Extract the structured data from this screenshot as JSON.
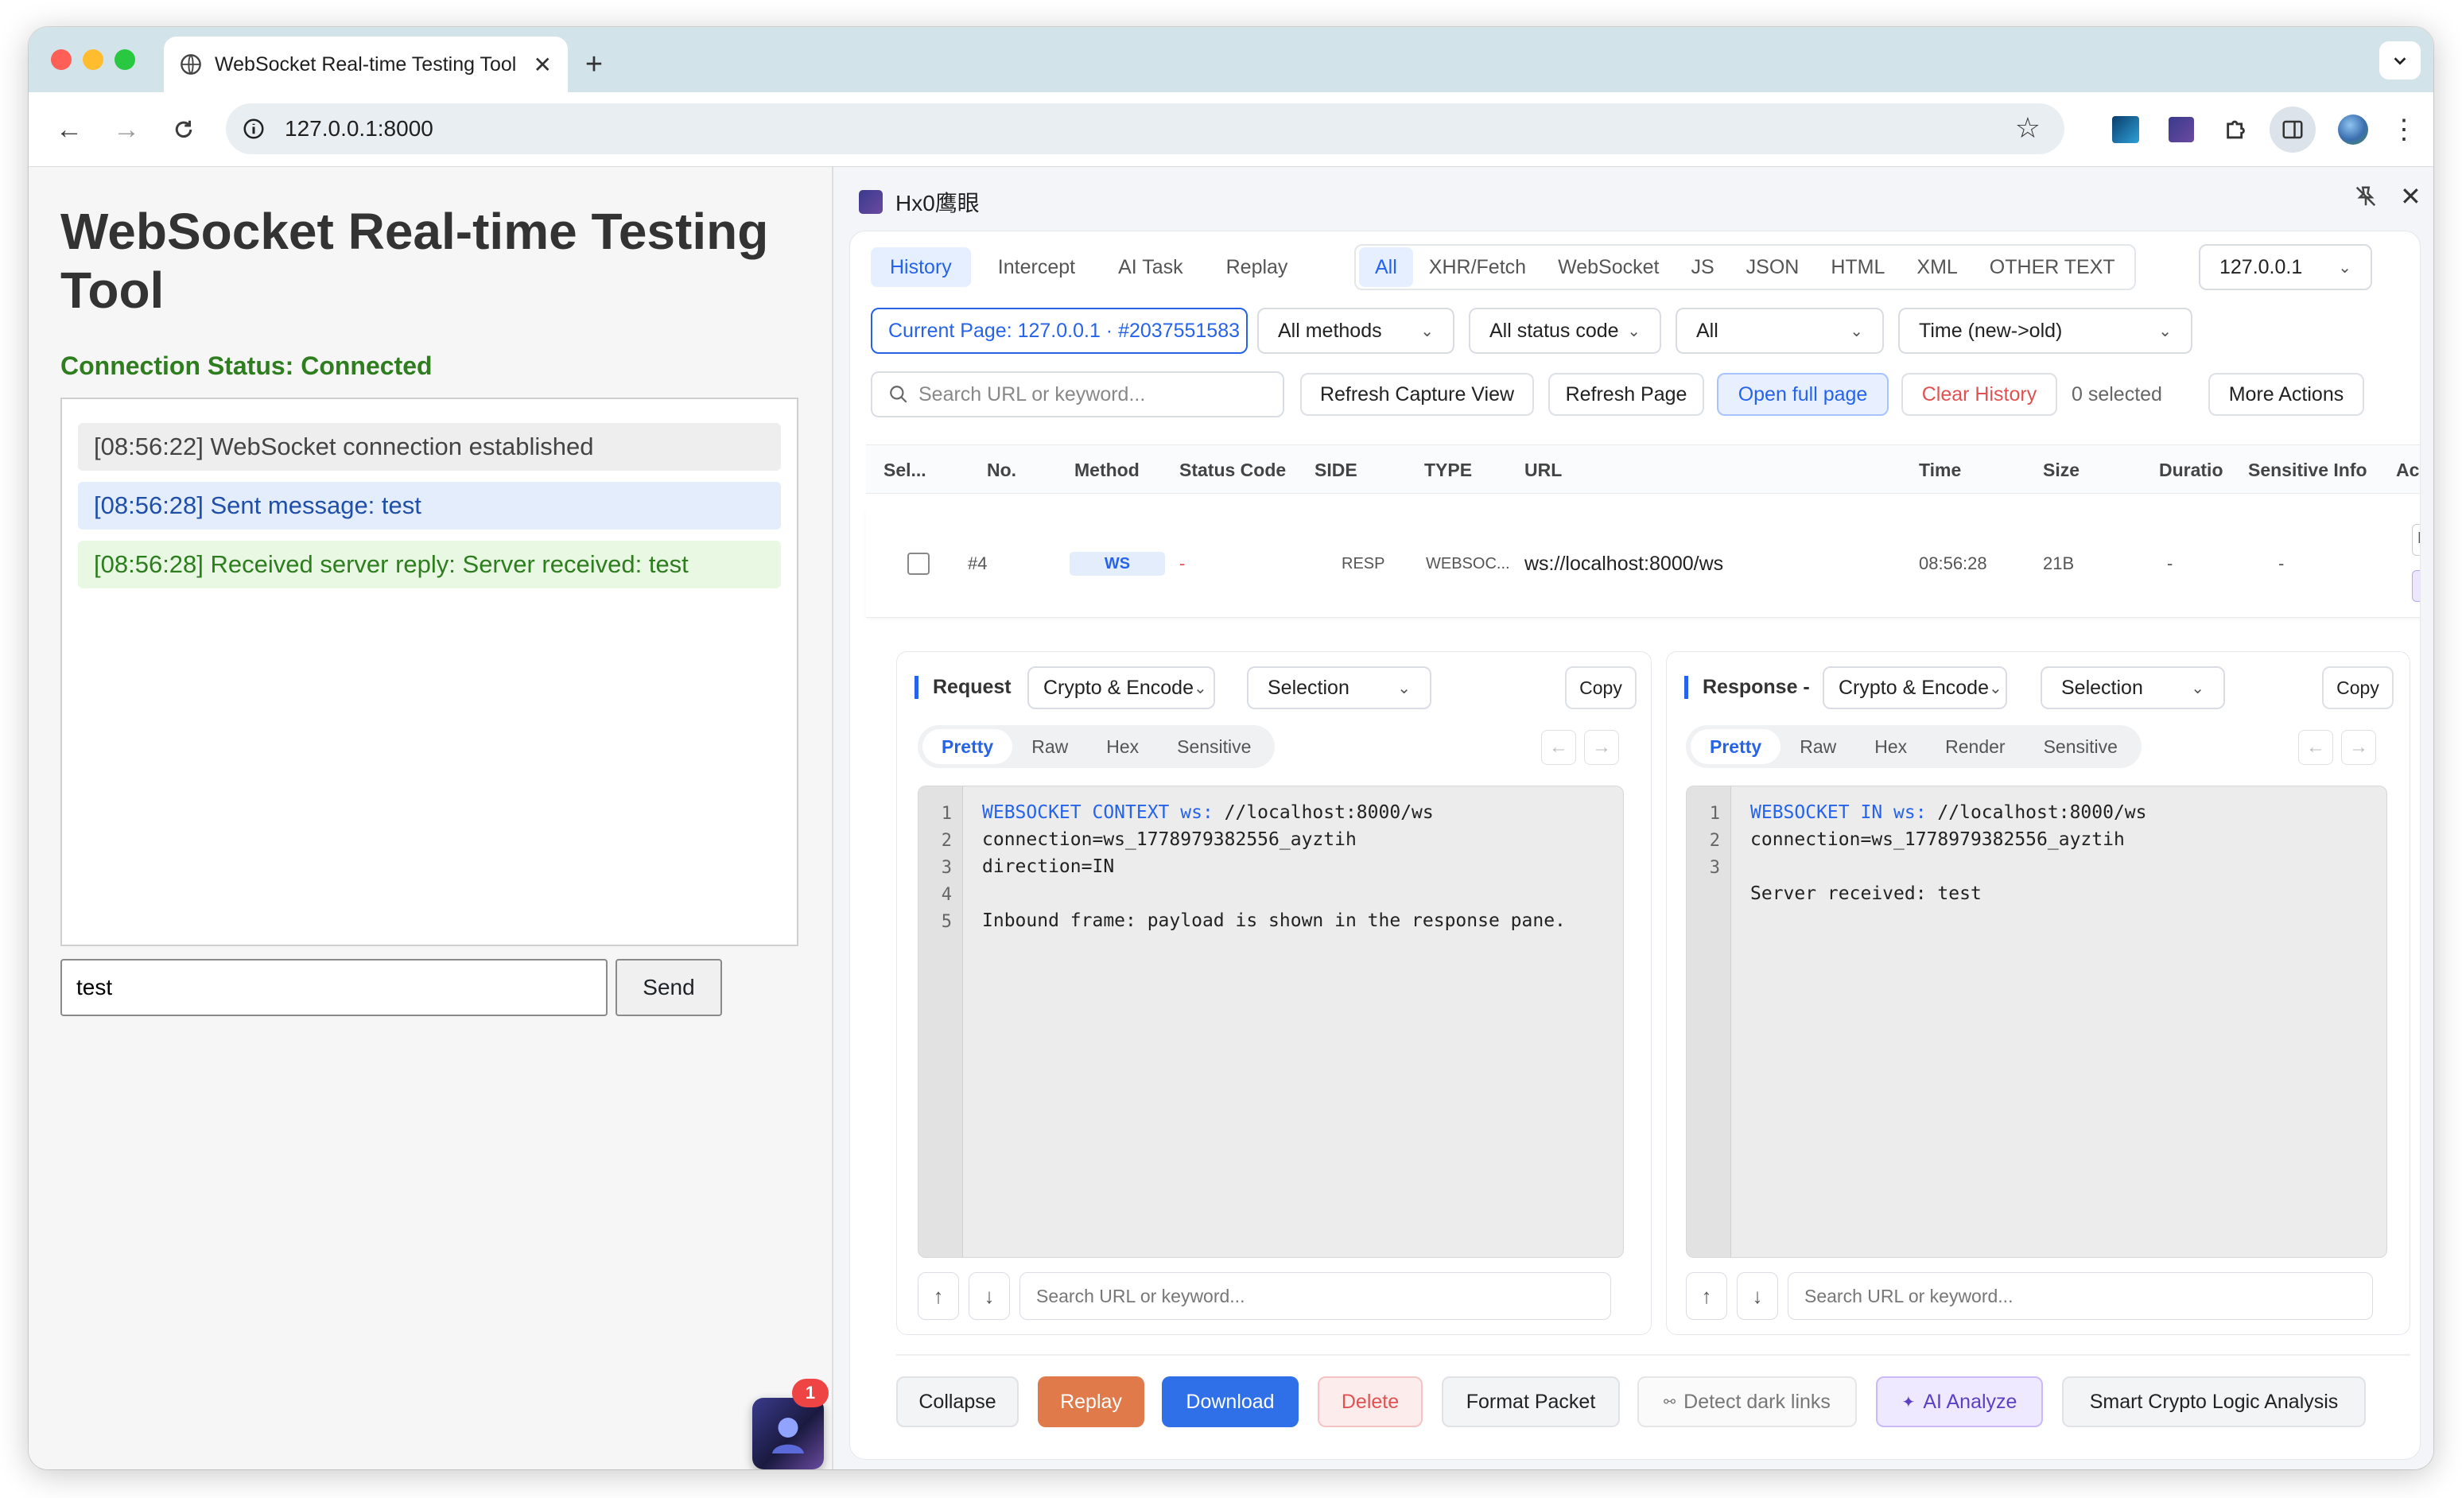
{
  "browser": {
    "tab_title": "WebSocket Real-time Testing Tool",
    "url": "127.0.0.1:8000"
  },
  "page": {
    "title": "WebSocket Real-time Testing Tool",
    "status": "Connection Status: Connected",
    "logs": [
      {
        "text": "[08:56:22] WebSocket connection established",
        "kind": "system"
      },
      {
        "text": "[08:56:28] Sent message: test",
        "kind": "sent"
      },
      {
        "text": "[08:56:28] Received server reply: Server received: test",
        "kind": "received"
      }
    ],
    "message_value": "test",
    "send_label": "Send",
    "badge_count": "1"
  },
  "panel": {
    "title": "Hx0鹰眼",
    "main_tabs": [
      "History",
      "Intercept",
      "AI Task",
      "Replay"
    ],
    "filter_tabs": [
      "All",
      "XHR/Fetch",
      "WebSocket",
      "JS",
      "JSON",
      "HTML",
      "XML",
      "OTHER TEXT"
    ],
    "host_select": "127.0.0.1",
    "current_page": "Current Page: 127.0.0.1 · #2037551583",
    "methods_select": "All methods",
    "status_select": "All status code",
    "all_select": "All",
    "time_select": "Time (new->old)",
    "search_placeholder": "Search URL or keyword...",
    "buttons": {
      "refresh_capture": "Refresh Capture View",
      "refresh_page": "Refresh Page",
      "open_full": "Open full page",
      "clear_history": "Clear History",
      "selected": "0 selected",
      "more_actions": "More Actions"
    },
    "columns": [
      "Sel...",
      "No.",
      "Method",
      "Status Code",
      "SIDE",
      "TYPE",
      "URL",
      "Time",
      "Size",
      "Duratio",
      "Sensitive Info",
      "Ac"
    ],
    "row": {
      "no": "#4",
      "method": "WS",
      "status": "-",
      "side": "RESP",
      "type": "WEBSOC...",
      "url": "ws://localhost:8000/ws",
      "time": "08:56:28",
      "size": "21B",
      "duration": "-",
      "sensitive": "-",
      "action_partial": "D"
    },
    "request": {
      "label": "Request",
      "crypto": "Crypto & Encode",
      "selection": "Selection",
      "copy": "Copy",
      "view_tabs": [
        "Pretty",
        "Raw",
        "Hex",
        "Sensitive"
      ],
      "lines": [
        {
          "kw": "WEBSOCKET CONTEXT ws:",
          "rest": " //localhost:8000/ws"
        },
        {
          "kw": "",
          "rest": "connection=ws_1778979382556_ayztih"
        },
        {
          "kw": "",
          "rest": "direction=IN"
        },
        {
          "kw": "",
          "rest": ""
        },
        {
          "kw": "",
          "rest": "Inbound frame: payload is shown in the response pane."
        }
      ],
      "search_placeholder": "Search URL or keyword..."
    },
    "response": {
      "label": "Response -",
      "crypto": "Crypto & Encode",
      "selection": "Selection",
      "copy": "Copy",
      "view_tabs": [
        "Pretty",
        "Raw",
        "Hex",
        "Render",
        "Sensitive"
      ],
      "lines": [
        {
          "kw": "WEBSOCKET IN ws:",
          "rest": " //localhost:8000/ws"
        },
        {
          "kw": "",
          "rest": "connection=ws_1778979382556_ayztih"
        },
        {
          "kw": "",
          "rest": ""
        },
        {
          "kw": "",
          "rest": "Server received: test"
        }
      ],
      "gutter": [
        "1",
        "2",
        "3"
      ],
      "search_placeholder": "Search URL or keyword..."
    },
    "actions": {
      "collapse": "Collapse",
      "replay": "Replay",
      "download": "Download",
      "delete": "Delete",
      "format": "Format Packet",
      "dark_links": "Detect dark links",
      "ai_analyze": "AI Analyze",
      "smart_crypto": "Smart Crypto Logic Analysis"
    }
  },
  "colors": {
    "accent": "#2563eb",
    "connected": "#2e7d1f",
    "replay": "#e07a4a",
    "delete": "#e05252"
  }
}
